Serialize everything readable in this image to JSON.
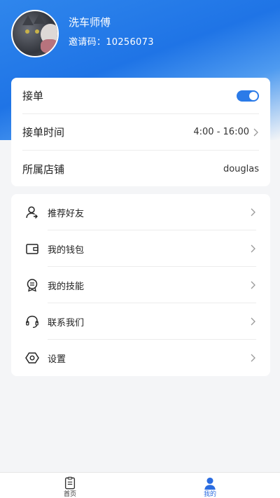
{
  "profile": {
    "name": "洗车师傅",
    "invite_code": "邀请码：10256073"
  },
  "settings_card": {
    "accept_orders_label": "接单",
    "accept_orders_enabled": true,
    "order_time_label": "接单时间",
    "order_time_value": "4:00 - 16:00",
    "store_label": "所属店铺",
    "store_value": "douglas"
  },
  "menu": [
    {
      "label": "推荐好友",
      "icon": "user-icon"
    },
    {
      "label": "我的钱包",
      "icon": "wallet-icon"
    },
    {
      "label": "我的技能",
      "icon": "skills-icon"
    },
    {
      "label": "联系我们",
      "icon": "headset-icon"
    },
    {
      "label": "设置",
      "icon": "settings-hex-icon"
    }
  ],
  "tabbar": {
    "home_label": "首页",
    "mine_label": "我的",
    "active_color": "#2b6ce0"
  },
  "colors": {
    "primary": "#2b7be8",
    "background": "#f4f5f7"
  }
}
